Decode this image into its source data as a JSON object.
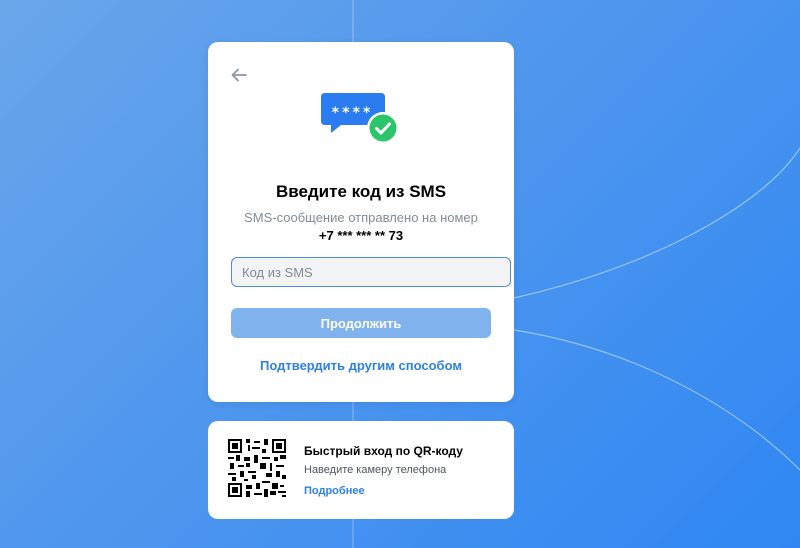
{
  "auth_card": {
    "title": "Введите код из SMS",
    "subtitle": "SMS-сообщение отправлено на номер",
    "phone": "+7 *** *** ** 73",
    "code_input": {
      "placeholder": "Код из SMS",
      "value": ""
    },
    "continue_label": "Продолжить",
    "alternate_link": "Подтвердить другим способом",
    "hero_bubble_text": "****"
  },
  "qr_card": {
    "title": "Быстрый вход по QR-коду",
    "description": "Наведите камеру телефона",
    "more_link": "Подробнее"
  },
  "icons": {
    "back": "arrow-left-icon",
    "hero": "sms-code-check-icon",
    "qr": "qr-code-icon"
  },
  "colors": {
    "accent": "#2d81e0",
    "button_disabled": "#80b3ee",
    "success": "#2bc66b",
    "bubble": "#2b7cf0"
  }
}
